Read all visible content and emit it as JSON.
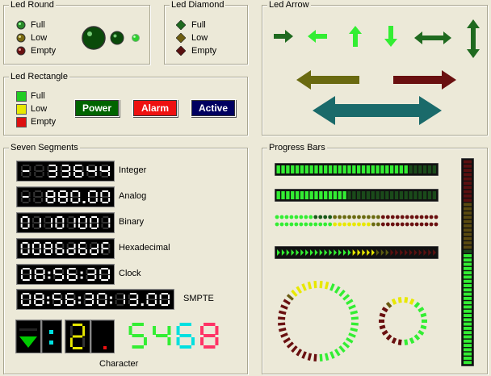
{
  "led_round": {
    "title": "Led Round",
    "items": [
      {
        "label": "Full",
        "color": "#2a8a2a"
      },
      {
        "label": "Low",
        "color": "#7a6a10"
      },
      {
        "label": "Empty",
        "color": "#6a1010"
      }
    ]
  },
  "led_diamond": {
    "title": "Led Diamond",
    "items": [
      {
        "label": "Full",
        "color": "#1f6a1f"
      },
      {
        "label": "Low",
        "color": "#6e5e10"
      },
      {
        "label": "Empty",
        "color": "#5a1010"
      }
    ]
  },
  "led_arrow": {
    "title": "Led Arrow"
  },
  "led_rectangle": {
    "title": "Led Rectangle",
    "items": [
      {
        "label": "Full",
        "color": "#22cc22"
      },
      {
        "label": "Low",
        "color": "#e8e800"
      },
      {
        "label": "Empty",
        "color": "#dd1010"
      }
    ],
    "buttons": [
      {
        "label": "Power",
        "bg": "#006400"
      },
      {
        "label": "Alarm",
        "bg": "#ee1111"
      },
      {
        "label": "Active",
        "bg": "#000060"
      }
    ]
  },
  "seven_segments": {
    "title": "Seven Segments",
    "rows": [
      {
        "label": "Integer",
        "value": "+ 33644"
      },
      {
        "label": "Analog",
        "value": "+ 880.00"
      },
      {
        "label": "Binary",
        "value": "01101001"
      },
      {
        "label": "Hexadecimal",
        "value": "0086D6DF"
      },
      {
        "label": "Clock",
        "value": "08:56:30"
      },
      {
        "label": "SMPTE",
        "value": "08:56:30:13.00"
      }
    ],
    "character_label": "Character",
    "character_digits": "5468"
  },
  "progress_bars": {
    "title": "Progress Bars",
    "bar1": 0.82,
    "bar2": 0.42,
    "bar3": 0.58,
    "bar4": 0.62,
    "vertical": 0.55,
    "ring1": 0.62,
    "ring2": 0.6
  }
}
